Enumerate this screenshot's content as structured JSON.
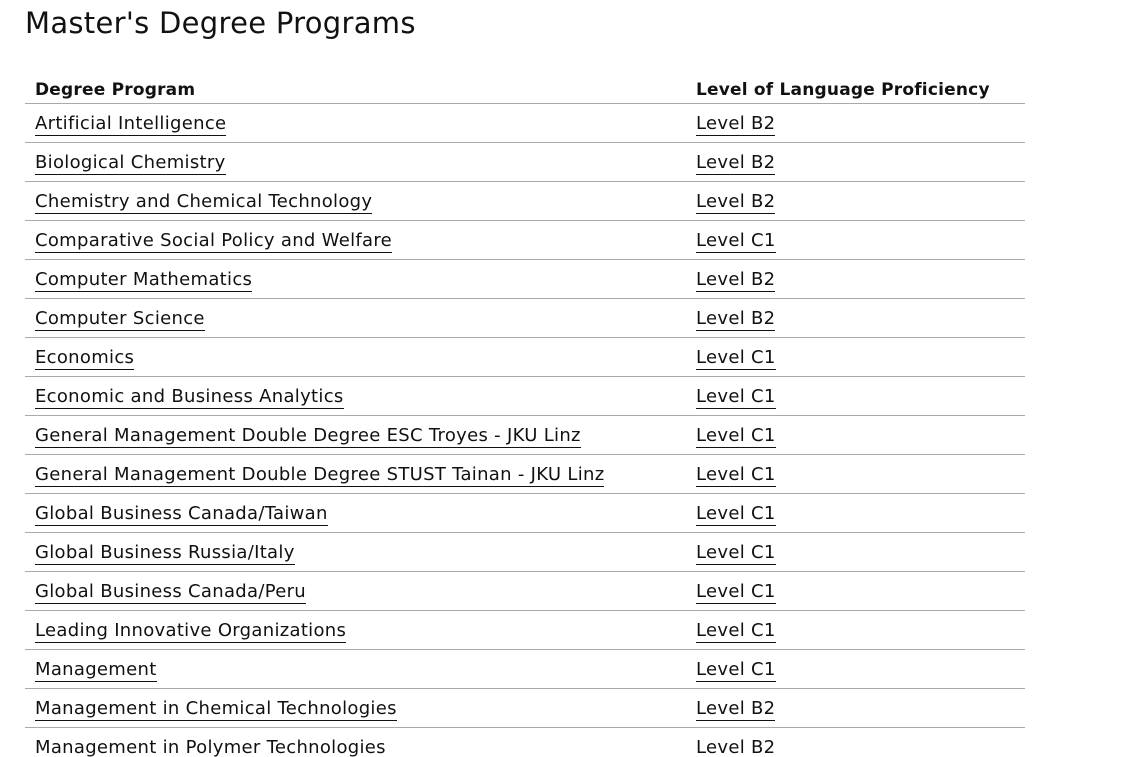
{
  "page": {
    "title": "Master's Degree Programs"
  },
  "table": {
    "headers": [
      "Degree Program",
      "Level of Language Proficiency"
    ],
    "rows": [
      {
        "program": "Artificial Intelligence",
        "level": "Level B2"
      },
      {
        "program": "Biological Chemistry",
        "level": "Level B2"
      },
      {
        "program": "Chemistry and Chemical Technology",
        "level": "Level B2"
      },
      {
        "program": "Comparative Social Policy and Welfare",
        "level": "Level C1"
      },
      {
        "program": "Computer Mathematics",
        "level": "Level B2"
      },
      {
        "program": "Computer Science",
        "level": "Level B2"
      },
      {
        "program": "Economics",
        "level": "Level C1"
      },
      {
        "program": "Economic and Business Analytics",
        "level": "Level C1"
      },
      {
        "program": "General Management Double Degree ESC Troyes - JKU Linz",
        "level": "Level C1"
      },
      {
        "program": "General Management Double Degree STUST Tainan - JKU Linz",
        "level": "Level C1"
      },
      {
        "program": "Global Business Canada/Taiwan",
        "level": "Level C1"
      },
      {
        "program": "Global Business Russia/Italy",
        "level": "Level C1"
      },
      {
        "program": "Global Business Canada/Peru",
        "level": "Level C1"
      },
      {
        "program": "Leading Innovative Organizations",
        "level": "Level C1"
      },
      {
        "program": "Management",
        "level": "Level C1"
      },
      {
        "program": "Management in Chemical Technologies",
        "level": "Level B2"
      },
      {
        "program": "Management in Polymer Technologies",
        "level": "Level B2"
      }
    ]
  }
}
